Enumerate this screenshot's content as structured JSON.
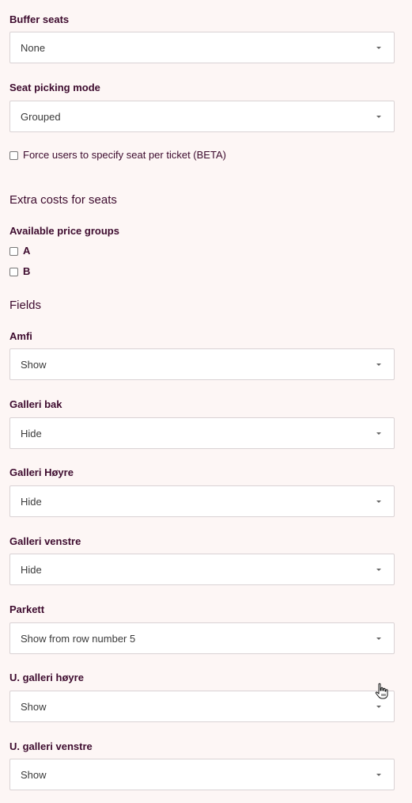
{
  "seat_settings": {
    "buffer_seats": {
      "label": "Buffer seats",
      "value": "None"
    },
    "seat_picking_mode": {
      "label": "Seat picking mode",
      "value": "Grouped"
    },
    "force_seat_per_ticket": {
      "label": "Force users to specify seat per ticket (BETA)",
      "checked": false
    }
  },
  "extra_costs": {
    "title": "Extra costs for seats",
    "price_groups_label": "Available price groups",
    "price_groups": [
      {
        "label": "A",
        "checked": false
      },
      {
        "label": "B",
        "checked": false
      }
    ]
  },
  "fields": {
    "title": "Fields",
    "items": [
      {
        "label": "Amfi",
        "value": "Show"
      },
      {
        "label": "Galleri bak",
        "value": "Hide"
      },
      {
        "label": "Galleri Høyre",
        "value": "Hide"
      },
      {
        "label": "Galleri venstre",
        "value": "Hide"
      },
      {
        "label": "Parkett",
        "value": "Show from row number 5"
      },
      {
        "label": "U. galleri høyre",
        "value": "Show"
      },
      {
        "label": "U. galleri venstre",
        "value": "Show"
      }
    ]
  },
  "icons": {
    "dropdown": "caret-down-icon",
    "cursor": "hand-pointer-icon"
  },
  "colors": {
    "background": "#fdf6f5",
    "text": "#3d0b2e",
    "select_border": "#d9d2d4"
  }
}
